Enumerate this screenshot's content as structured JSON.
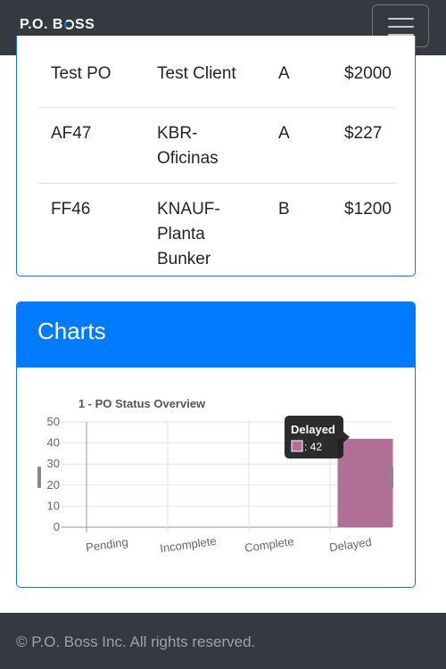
{
  "brand": {
    "prefix": "P.O. B",
    "suffix": "SS"
  },
  "table": {
    "rows": [
      {
        "po": "Test PO",
        "client": "Test Client",
        "category": "A",
        "amount": "$2000"
      },
      {
        "po": "AF47",
        "client": "KBR-Oficinas",
        "category": "A",
        "amount": "$227"
      },
      {
        "po": "FF46",
        "client": "KNAUF-Planta Bunker",
        "category": "B",
        "amount": "$1200"
      }
    ]
  },
  "charts": {
    "heading": "Charts"
  },
  "chart_data": {
    "type": "bar",
    "title": "1 - PO Status Overview",
    "categories": [
      "Pending",
      "Incomplete",
      "Complete",
      "Delayed"
    ],
    "values": [
      0,
      0,
      0,
      42
    ],
    "ylim": [
      0,
      50
    ],
    "yticks": [
      0,
      10,
      20,
      30,
      40,
      50
    ],
    "grid": true,
    "bar_color": "#b07096",
    "tooltip": {
      "title": "Delayed",
      "value_text": ": 42"
    }
  },
  "colors": {
    "navbar": "#343a40",
    "primary": "#007bff",
    "footer_text": "#9da2a7"
  },
  "footer": {
    "text": "© P.O. Boss Inc. All rights reserved."
  }
}
